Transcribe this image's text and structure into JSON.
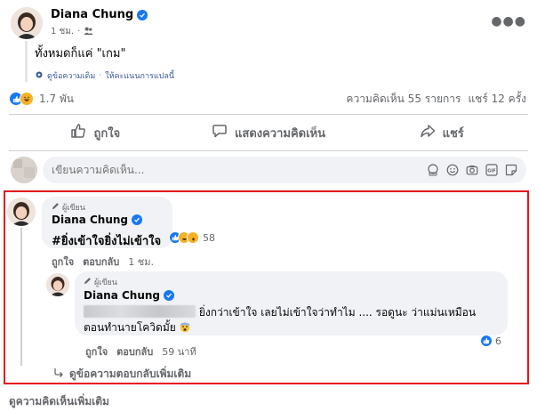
{
  "post": {
    "author": "Diana Chung",
    "time": "1 ชม.",
    "text": "ทั้งหมดก็แค่ \"เกม\"",
    "see_original": "ดูข้อความเดิม",
    "separator": "·",
    "rate_translation": "ให้คะแนนการแปลนี้"
  },
  "stats": {
    "reactions_count": "1.7 พัน",
    "comments_count": "ความคิดเห็น 55 รายการ",
    "shares_count": "แชร์ 12 ครั้ง"
  },
  "actions": {
    "like": "ถูกใจ",
    "comment": "แสดงความคิดเห็น",
    "share": "แชร์"
  },
  "compose": {
    "placeholder": "เขียนความคิดเห็น..."
  },
  "comment": {
    "badge": "ผู้เขียน",
    "author": "Diana Chung",
    "text": "#ยิ่งเข้าใจยิ่งไม่เข้าใจ",
    "reactions_count": "58",
    "like": "ถูกใจ",
    "reply": "ตอบกลับ",
    "time": "1 ชม."
  },
  "reply": {
    "badge": "ผู้เขียน",
    "author": "Diana Chung",
    "text_line1": " ยิ่งกว่าเข้าใจ เลยไม่เข้าใจว่าทำไม .... รอดูนะ ว่าแม่นเหมือน",
    "text_line2": "ตอนทำนายโควิดมั้ย",
    "reactions_count": "6",
    "like": "ถูกใจ",
    "reply": "ตอบกลับ",
    "time": "59 นาที"
  },
  "more_replies": "ดูข้อความตอบกลับเพิ่มเติม",
  "more_comments": "ดูความคิดเห็นเพิ่มเติม",
  "colors": {
    "accent": "#1877f2",
    "highlight_border": "#e4131f",
    "muted_text": "#65676b",
    "bubble_bg": "#f0f2f5"
  }
}
